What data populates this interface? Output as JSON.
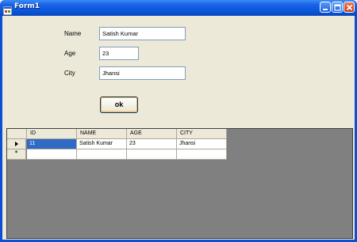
{
  "window": {
    "title": "Form1"
  },
  "form": {
    "name_label": "Name",
    "name_value": "Satish Kumar",
    "age_label": "Age",
    "age_value": "23",
    "city_label": "City",
    "city_value": "Jhansi",
    "ok_label": "ok"
  },
  "grid": {
    "columns": [
      "ID",
      "NAME",
      "AGE",
      "CITY"
    ],
    "rows": [
      [
        "11",
        "Satish Kumar",
        "23",
        "Jhansi"
      ]
    ],
    "new_row_marker": "*"
  },
  "colors": {
    "titlebar": "#0a55d8",
    "form_bg": "#ece9d8",
    "grid_bg": "#808080",
    "selection": "#316ac5"
  }
}
